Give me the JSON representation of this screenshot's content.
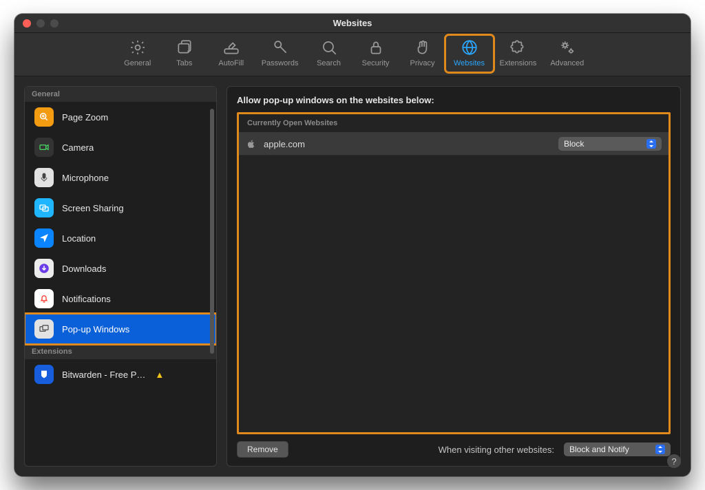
{
  "window": {
    "title": "Websites"
  },
  "toolbar": {
    "items": [
      {
        "label": "General"
      },
      {
        "label": "Tabs"
      },
      {
        "label": "AutoFill"
      },
      {
        "label": "Passwords"
      },
      {
        "label": "Search"
      },
      {
        "label": "Security"
      },
      {
        "label": "Privacy"
      },
      {
        "label": "Websites"
      },
      {
        "label": "Extensions"
      },
      {
        "label": "Advanced"
      }
    ]
  },
  "sidebar": {
    "section1": "General",
    "section2": "Extensions",
    "items": [
      {
        "label": "Page Zoom"
      },
      {
        "label": "Camera"
      },
      {
        "label": "Microphone"
      },
      {
        "label": "Screen Sharing"
      },
      {
        "label": "Location"
      },
      {
        "label": "Downloads"
      },
      {
        "label": "Notifications"
      },
      {
        "label": "Pop-up Windows"
      }
    ],
    "ext": {
      "label": "Bitwarden - Free P…"
    }
  },
  "main": {
    "heading": "Allow pop-up windows on the websites below:",
    "list_header": "Currently Open Websites",
    "rows": [
      {
        "site": "apple.com",
        "setting": "Block"
      }
    ],
    "remove": "Remove",
    "footer_label": "When visiting other websites:",
    "default_setting": "Block and Notify"
  }
}
